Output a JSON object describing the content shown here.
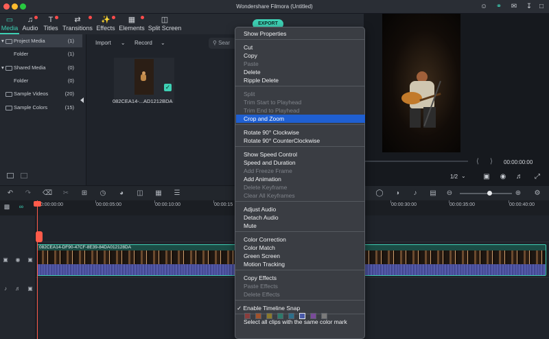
{
  "window": {
    "title": "Wondershare Filmora (Untitled)"
  },
  "tabs": [
    {
      "label": "Media",
      "icon": "folder-icon"
    },
    {
      "label": "Audio",
      "icon": "music-icon"
    },
    {
      "label": "Titles",
      "icon": "text-icon"
    },
    {
      "label": "Transitions",
      "icon": "transition-icon"
    },
    {
      "label": "Effects",
      "icon": "effects-icon"
    },
    {
      "label": "Elements",
      "icon": "elements-icon"
    },
    {
      "label": "Split Screen",
      "icon": "split-screen-icon"
    }
  ],
  "export_label": "EXPORT",
  "sidebar": {
    "items": [
      {
        "label": "Project Media",
        "count": "(1)"
      },
      {
        "label": "Folder",
        "count": "(1)"
      },
      {
        "label": "Shared Media",
        "count": "(0)"
      },
      {
        "label": "Folder",
        "count": "(0)"
      },
      {
        "label": "Sample Videos",
        "count": "(20)"
      },
      {
        "label": "Sample Colors",
        "count": "(15)"
      }
    ]
  },
  "media": {
    "import_label": "Import",
    "record_label": "Record",
    "search_placeholder": "Sear",
    "clip_name": "082CEA14-...AD1212BDA"
  },
  "preview": {
    "timecode": "00:00:00:00",
    "zoom": "1/2"
  },
  "timeline": {
    "ruler": [
      "00:00:00:00",
      "00:00:05:00",
      "00:00:10:00",
      "00:00:15",
      "00:00:30:00",
      "00:00:35:00",
      "00:00:40:00"
    ],
    "clip_label": "082CEA14-DF90-47CF-8E39-84DA012128DA"
  },
  "context_menu": {
    "items": [
      {
        "label": "Show Properties",
        "enabled": true
      },
      {
        "label": "Cut",
        "enabled": true
      },
      {
        "label": "Copy",
        "enabled": true
      },
      {
        "label": "Paste",
        "enabled": false
      },
      {
        "label": "Delete",
        "enabled": true
      },
      {
        "label": "Ripple Delete",
        "enabled": true
      },
      {
        "label": "Split",
        "enabled": false
      },
      {
        "label": "Trim Start to Playhead",
        "enabled": false
      },
      {
        "label": "Trim End to Playhead",
        "enabled": false
      },
      {
        "label": "Crop and Zoom",
        "enabled": true,
        "highlighted": true
      },
      {
        "label": "Rotate 90° Clockwise",
        "enabled": true
      },
      {
        "label": "Rotate 90° CounterClockwise",
        "enabled": true
      },
      {
        "label": "Show Speed Control",
        "enabled": true
      },
      {
        "label": "Speed and Duration",
        "enabled": true
      },
      {
        "label": "Add Freeze Frame",
        "enabled": false
      },
      {
        "label": "Add Animation",
        "enabled": true
      },
      {
        "label": "Delete Keyframe",
        "enabled": false
      },
      {
        "label": "Clear All Keyframes",
        "enabled": false
      },
      {
        "label": "Adjust Audio",
        "enabled": true
      },
      {
        "label": "Detach Audio",
        "enabled": true
      },
      {
        "label": "Mute",
        "enabled": true
      },
      {
        "label": "Color Correction",
        "enabled": true
      },
      {
        "label": "Color Match",
        "enabled": true
      },
      {
        "label": "Green Screen",
        "enabled": true
      },
      {
        "label": "Motion Tracking",
        "enabled": true
      },
      {
        "label": "Copy Effects",
        "enabled": true
      },
      {
        "label": "Paste Effects",
        "enabled": false
      },
      {
        "label": "Delete Effects",
        "enabled": false
      },
      {
        "label": "Enable Timeline Snap",
        "enabled": true,
        "checked": true
      },
      {
        "label": "Select all clips with the same color mark",
        "enabled": true
      }
    ],
    "color_marks": [
      "#8a3d3d",
      "#a0522d",
      "#8b7a2d",
      "#2d7a6b",
      "#2d6f8b",
      "#4a5aa8",
      "#7a4a9a",
      "#7a7a7a"
    ],
    "selected_color_mark": 5
  },
  "colors": {
    "accent": "#3ed0b4",
    "menu_highlight": "#1f5fd1",
    "playhead": "#ff5b4a"
  }
}
